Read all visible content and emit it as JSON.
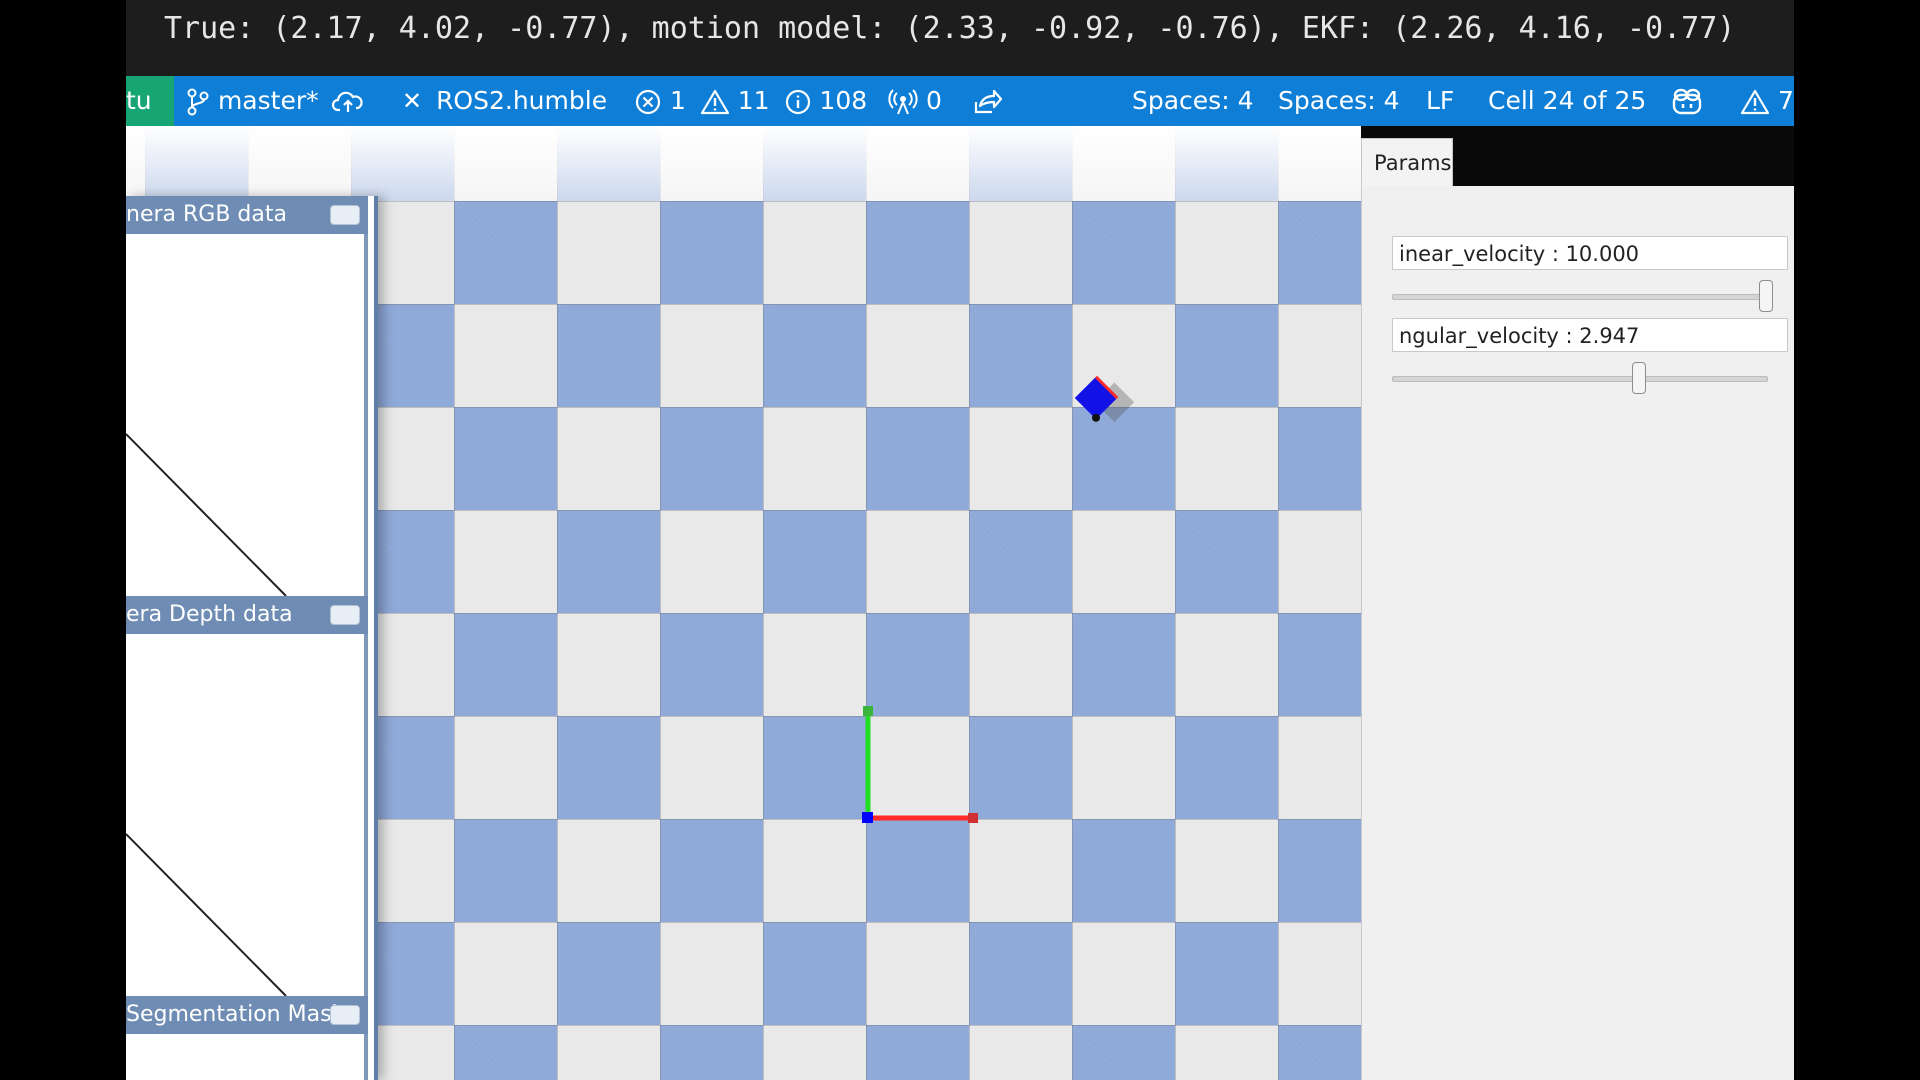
{
  "top_bar": {
    "readout": "True: (2.17, 4.02, -0.77), motion model: (2.33, -0.92, -0.76), EKF: (2.26, 4.16, -0.77)"
  },
  "status_bar": {
    "left_item": "tu",
    "branch": "master*",
    "remote": "ROS2.humble",
    "errors": "1",
    "warnings": "11",
    "infos": "108",
    "ports": "0",
    "spaces_1": "Spaces: 4",
    "spaces_2": "Spaces: 4",
    "eol": "LF",
    "cell": "Cell 24 of 25",
    "right_warnings": "7",
    "colors": {
      "bar": "#0e7ed6",
      "left_item": "#17a673"
    }
  },
  "left_panel": {
    "panels": [
      {
        "title": "nera RGB data"
      },
      {
        "title": "era Depth data"
      },
      {
        "title": "Segmentation Mask"
      }
    ]
  },
  "params_panel": {
    "tab_label": "Params",
    "linear_velocity": {
      "label": "inear_velocity : 10.000",
      "slider_fraction": 1.0
    },
    "angular_velocity": {
      "label": "ngular_velocity : 2.947",
      "slider_fraction": 0.66
    }
  },
  "scene": {
    "floor_colors": {
      "dark_tile": "#8fa9d9",
      "light_tile": "#e9e9ea"
    },
    "axes_colors": {
      "x": "#ff2a2a",
      "y": "#22dd22",
      "origin": "#0000ff"
    },
    "robot_color": "#1212e6"
  }
}
